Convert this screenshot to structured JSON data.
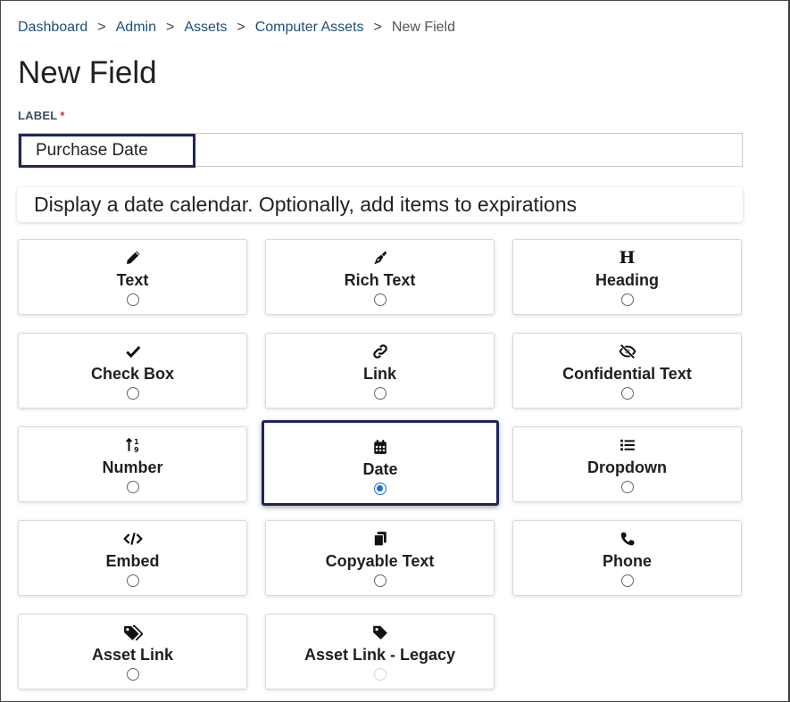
{
  "breadcrumb": {
    "items": [
      "Dashboard",
      "Admin",
      "Assets",
      "Computer Assets"
    ],
    "current": "New Field",
    "separator": ">"
  },
  "page": {
    "title": "New Field"
  },
  "label_field": {
    "label": "LABEL",
    "required_marker": "*",
    "value": "Purchase Date"
  },
  "description": "Display a date calendar. Optionally, add items to expirations",
  "field_types": [
    {
      "name": "Text",
      "icon": "pencil-icon",
      "selected": false,
      "disabled": false
    },
    {
      "name": "Rich Text",
      "icon": "pen-nib-icon",
      "selected": false,
      "disabled": false
    },
    {
      "name": "Heading",
      "icon": "heading-icon",
      "selected": false,
      "disabled": false
    },
    {
      "name": "Check Box",
      "icon": "check-icon",
      "selected": false,
      "disabled": false
    },
    {
      "name": "Link",
      "icon": "link-icon",
      "selected": false,
      "disabled": false
    },
    {
      "name": "Confidential Text",
      "icon": "eye-slash-icon",
      "selected": false,
      "disabled": false
    },
    {
      "name": "Number",
      "icon": "sort-numeric-icon",
      "selected": false,
      "disabled": false
    },
    {
      "name": "Date",
      "icon": "calendar-icon",
      "selected": true,
      "disabled": false
    },
    {
      "name": "Dropdown",
      "icon": "list-icon",
      "selected": false,
      "disabled": false
    },
    {
      "name": "Embed",
      "icon": "code-icon",
      "selected": false,
      "disabled": false
    },
    {
      "name": "Copyable Text",
      "icon": "copy-icon",
      "selected": false,
      "disabled": false
    },
    {
      "name": "Phone",
      "icon": "phone-icon",
      "selected": false,
      "disabled": false
    },
    {
      "name": "Asset Link",
      "icon": "tags-icon",
      "selected": false,
      "disabled": false
    },
    {
      "name": "Asset Link - Legacy",
      "icon": "tag-icon",
      "selected": false,
      "disabled": true
    }
  ],
  "colors": {
    "link": "#1c4f7c",
    "highlight": "#1d2559",
    "required": "#e12a2a",
    "radio_selected": "#1b6fd6"
  }
}
